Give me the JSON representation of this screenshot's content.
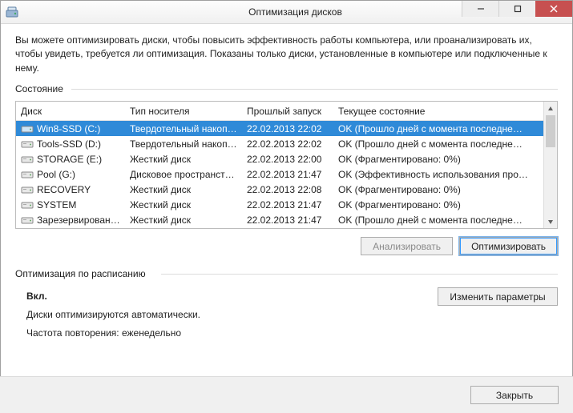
{
  "window": {
    "title": "Оптимизация дисков"
  },
  "description": "Вы можете оптимизировать диски, чтобы повысить эффективность работы  компьютера, или проанализировать их, чтобы увидеть, требуется ли оптимизация. Показаны только диски, установленные в компьютере или подключенные к нему.",
  "state_label": "Состояние",
  "columns": {
    "disk": "Диск",
    "media": "Тип носителя",
    "lastrun": "Прошлый запуск",
    "status": "Текущее состояние"
  },
  "drives": [
    {
      "name": "Win8-SSD (C:)",
      "media": "Твердотельный накоп…",
      "lastrun": "22.02.2013 22:02",
      "status": "OK (Прошло дней с момента последне…",
      "selected": true
    },
    {
      "name": "Tools-SSD (D:)",
      "media": "Твердотельный накоп…",
      "lastrun": "22.02.2013 22:02",
      "status": "OK (Прошло дней с момента последне…",
      "selected": false
    },
    {
      "name": "STORAGE (E:)",
      "media": "Жесткий диск",
      "lastrun": "22.02.2013 22:00",
      "status": "OK (Фрагментировано: 0%)",
      "selected": false
    },
    {
      "name": "Pool (G:)",
      "media": "Дисковое пространств…",
      "lastrun": "22.02.2013 21:47",
      "status": "OK (Эффективность использования про…",
      "selected": false
    },
    {
      "name": "RECOVERY",
      "media": "Жесткий диск",
      "lastrun": "22.02.2013 22:08",
      "status": "OK (Фрагментировано: 0%)",
      "selected": false
    },
    {
      "name": "SYSTEM",
      "media": "Жесткий диск",
      "lastrun": "22.02.2013 21:47",
      "status": "OK (Фрагментировано: 0%)",
      "selected": false
    },
    {
      "name": "Зарезервирован…",
      "media": "Жесткий диск",
      "lastrun": "22.02.2013 21:47",
      "status": "OK (Прошло дней с момента последне…",
      "selected": false
    }
  ],
  "buttons": {
    "analyze": "Анализировать",
    "optimize": "Оптимизировать",
    "change": "Изменить параметры",
    "close": "Закрыть"
  },
  "schedule": {
    "label": "Оптимизация по расписанию",
    "on": "Вкл.",
    "auto": "Диски оптимизируются автоматически.",
    "freq": "Частота повторения: еженедельно"
  }
}
